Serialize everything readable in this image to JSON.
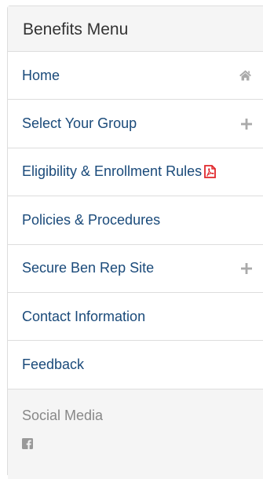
{
  "menu": {
    "title": "Benefits Menu",
    "items": [
      {
        "label": "Home",
        "icon": "home-icon"
      },
      {
        "label": "Select Your Group",
        "icon": "plus-icon"
      },
      {
        "label": "Eligibility & Enrollment Rules",
        "icon": "pdf-icon"
      },
      {
        "label": "Policies & Procedures",
        "icon": ""
      },
      {
        "label": "Secure Ben Rep Site",
        "icon": "plus-icon"
      },
      {
        "label": "Contact Information",
        "icon": ""
      },
      {
        "label": "Feedback",
        "icon": ""
      }
    ]
  },
  "social": {
    "title": "Social Media",
    "icon": "facebook-icon"
  },
  "colors": {
    "link": "#1a4a7a",
    "header_bg": "#f5f5f5",
    "border": "#dddddd",
    "pdf_red": "#e0272b",
    "icon_gray": "#aaaaaa"
  }
}
